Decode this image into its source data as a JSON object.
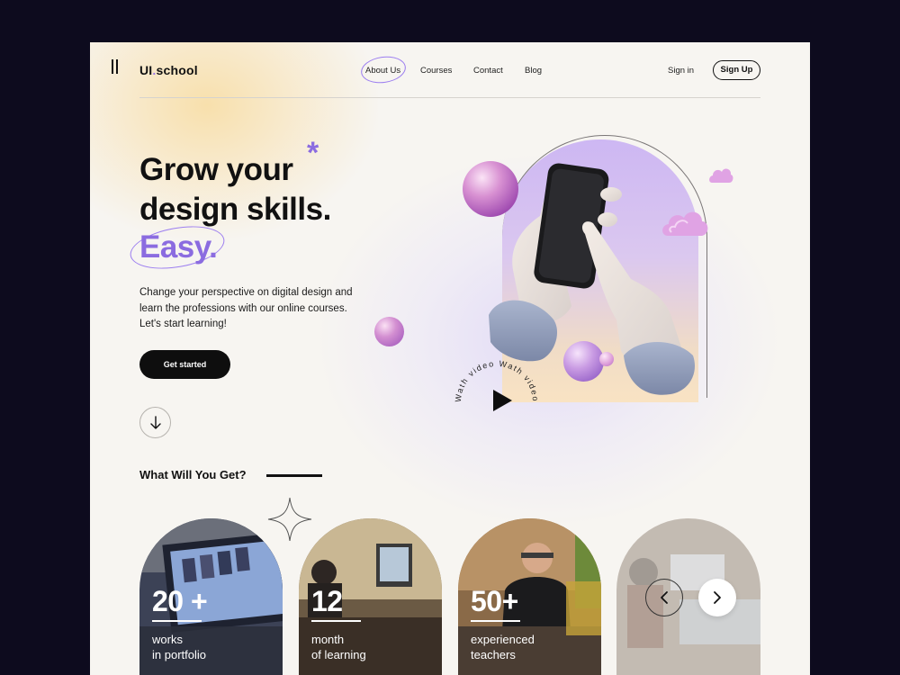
{
  "brand": {
    "name_prefix": "UI",
    "name_dot": ".",
    "name_suffix": "school"
  },
  "nav": {
    "items": [
      {
        "label": "About Us",
        "active": true
      },
      {
        "label": "Courses"
      },
      {
        "label": "Contact"
      },
      {
        "label": "Blog"
      }
    ],
    "signin_label": "Sign in",
    "signup_label": "Sign Up"
  },
  "hero": {
    "title_line1": "Grow your",
    "title_line2": "design skills.",
    "title_highlight": "Easy.",
    "asterisk": "*",
    "description": "Change your perspective on digital design and learn the professions  with our online courses. Let's start learning!",
    "cta_label": "Get started",
    "video_ring_text": "Wath video Wath video "
  },
  "section": {
    "title": "What Will You Get?",
    "stats": [
      {
        "value": "20 +",
        "label_line1": "works",
        "label_line2": "in portfolio"
      },
      {
        "value": "12",
        "label_line1": "month",
        "label_line2": "of learning"
      },
      {
        "value": "50+",
        "label_line1": "experienced",
        "label_line2": "teachers"
      }
    ]
  },
  "colors": {
    "accent": "#8b6ce0",
    "text": "#111111",
    "background": "#f7f5f1",
    "frame": "#0d0b1e"
  },
  "icons": {
    "logo": "logo-bars-icon",
    "scroll": "arrow-down-icon",
    "play": "play-icon",
    "prev": "chevron-left-icon",
    "next": "chevron-right-icon",
    "sparkle": "sparkle-icon"
  }
}
